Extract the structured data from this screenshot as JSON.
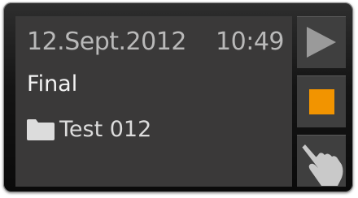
{
  "status": {
    "date": "12.Sept.2012",
    "time": "10:49"
  },
  "mode": {
    "label": "Final"
  },
  "folder": {
    "icon": "folder-icon",
    "name": "Test 012"
  },
  "controls": {
    "play": {
      "icon": "play-icon"
    },
    "stop": {
      "icon": "stop-icon",
      "color": "#f29400"
    },
    "touch": {
      "icon": "touch-hand-icon"
    }
  },
  "colors": {
    "screen": "#3a3939",
    "accent": "#f29400",
    "frame": "#141414"
  }
}
